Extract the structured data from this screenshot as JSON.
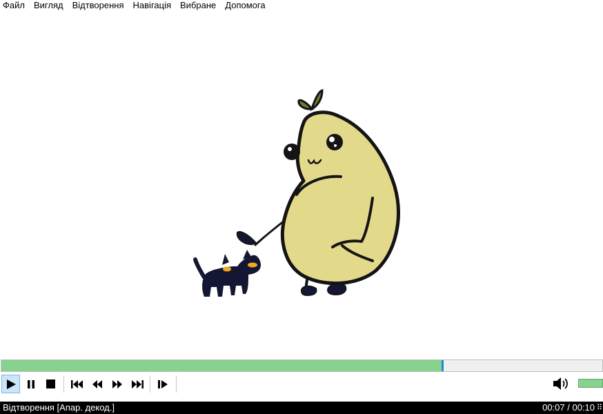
{
  "menu": {
    "items": [
      {
        "label": "Файл"
      },
      {
        "label": "Вигляд"
      },
      {
        "label": "Відтворення"
      },
      {
        "label": "Навігація"
      },
      {
        "label": "Вибране"
      },
      {
        "label": "Допомога"
      }
    ]
  },
  "player": {
    "progress": 0.733,
    "volume": 1.0,
    "controls": [
      {
        "name": "play-icon"
      },
      {
        "name": "pause-icon"
      },
      {
        "name": "stop-icon"
      },
      {
        "name": "skip-back-icon"
      },
      {
        "name": "rewind-icon"
      },
      {
        "name": "fast-forward-icon"
      },
      {
        "name": "skip-forward-icon"
      },
      {
        "name": "frame-step-icon"
      }
    ],
    "volume_icon": "speaker-icon"
  },
  "status": {
    "state": "Відтворення [Апар. декод.]",
    "time": "00:07 / 00:10",
    "grip": "⠿"
  },
  "colors": {
    "seek_fill": "#86d28e",
    "seek_handle": "#1b8dd9",
    "status_bg": "#000000",
    "bean_body": "#e3d98b",
    "leaf": "#6b7c2e",
    "cat": "#141733",
    "cat_eyes": "#f2a91e"
  }
}
